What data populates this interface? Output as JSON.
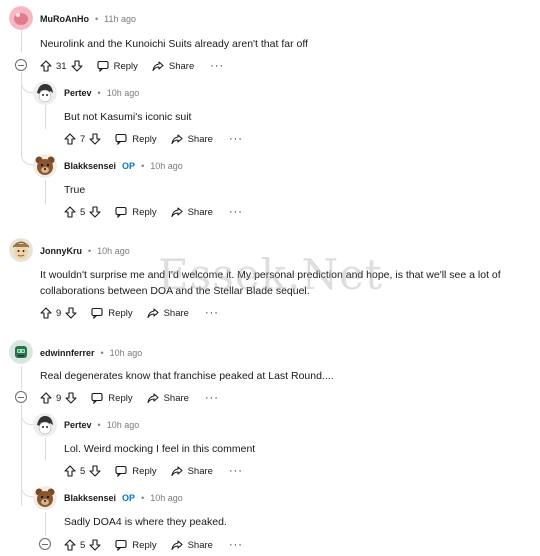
{
  "labels": {
    "reply": "Reply",
    "share": "Share",
    "more": "···",
    "op": "OP"
  },
  "watermark": "Essek.Net",
  "comments": [
    {
      "user": "MuRoAnHo",
      "time": "11h ago",
      "dot": "•",
      "text": "Neurolink and the Kunoichi Suits already aren't that far off",
      "votes": "31",
      "avatar": "pink-blob-avatar"
    },
    {
      "user": "Pertev",
      "time": "10h ago",
      "dot": "•",
      "text": "But not Kasumi's iconic suit",
      "votes": "7",
      "avatar": "anime-character-avatar"
    },
    {
      "user": "Blakksensei",
      "time": "10h ago",
      "dot": "•",
      "text": "True",
      "votes": "5",
      "avatar": "bear-avatar",
      "op": true
    },
    {
      "user": "JonnyKru",
      "time": "10h ago",
      "dot": "•",
      "text1": "It wouldn't surprise me and I'd welcome it. My personal prediction and hope, is that we'll see a lot of",
      "text2": "collaborations between DOA and the Stellar Blade sequel.",
      "votes": "9",
      "avatar": "cartoon-avatar"
    },
    {
      "user": "edwinnferrer",
      "time": "10h ago",
      "dot": "•",
      "text": "Real degenerates know that franchise peaked at Last Round....",
      "votes": "9",
      "avatar": "green-robot-avatar"
    },
    {
      "user": "Pertev",
      "time": "10h ago",
      "dot": "•",
      "text": "Lol. Weird mocking I feel in this comment",
      "votes": "5",
      "avatar": "anime-character-avatar"
    },
    {
      "user": "Blakksensei",
      "time": "10h ago",
      "dot": "•",
      "text": "Sadly DOA4 is where they peaked.",
      "votes": "5",
      "avatar": "bear-avatar",
      "op": true
    }
  ]
}
